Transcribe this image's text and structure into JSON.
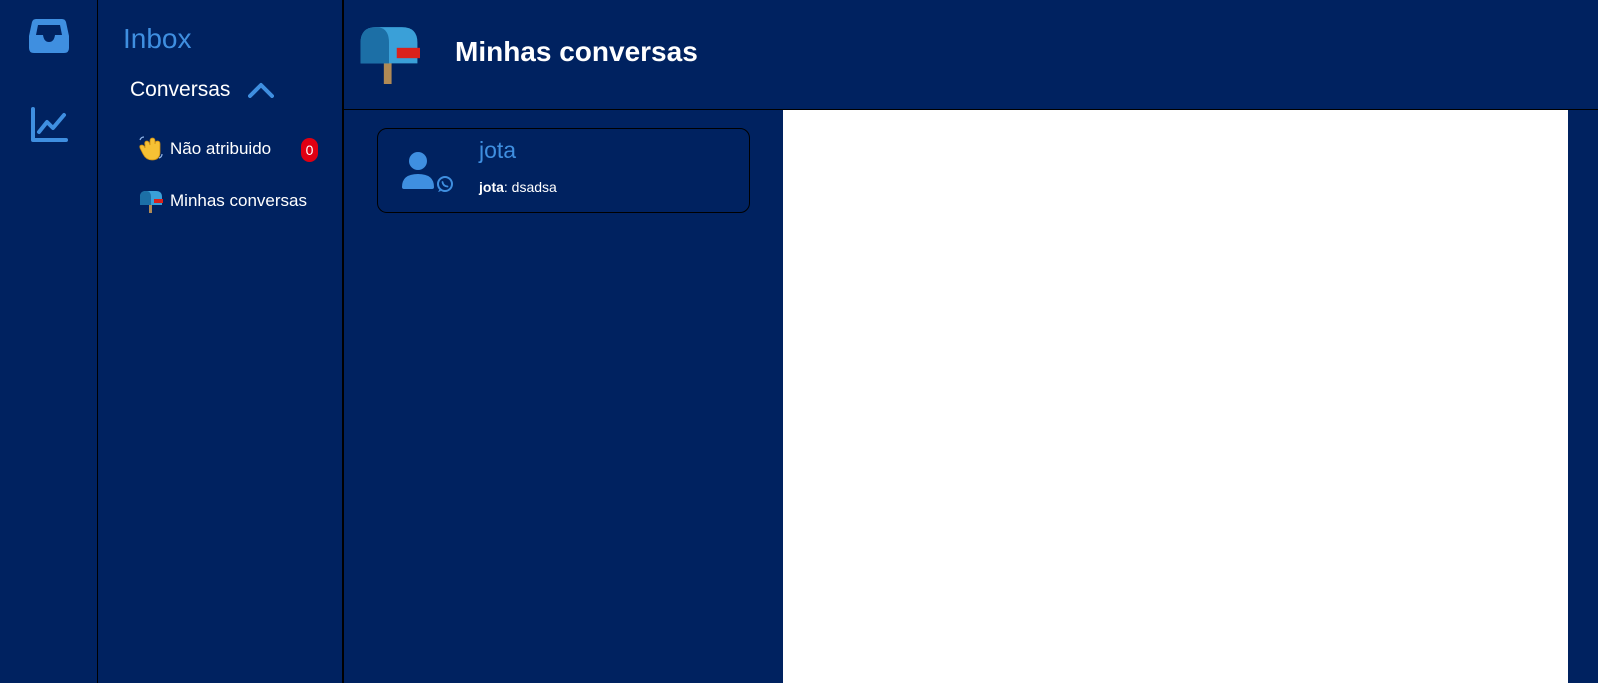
{
  "rail": {
    "items": [
      {
        "icon": "inbox-icon",
        "active": true
      },
      {
        "icon": "chart-line-icon",
        "active": false
      }
    ]
  },
  "nav": {
    "title": "Inbox",
    "section_label": "Conversas",
    "items": [
      {
        "emoji": "👋",
        "label": "Não atribuido",
        "count": "0"
      },
      {
        "emoji": "📪",
        "label": "Minhas conversas"
      }
    ]
  },
  "header": {
    "emoji": "📪",
    "title": "Minhas conversas"
  },
  "conversations": [
    {
      "name": "jota",
      "channel_icon": "whatsapp-icon",
      "preview_sender": "jota",
      "preview_separator": ":",
      "preview_text": " dsadsa"
    }
  ],
  "colors": {
    "background": "#002260",
    "accent": "#3f8fe0",
    "badge": "#e00012",
    "content": "#ffffff"
  }
}
